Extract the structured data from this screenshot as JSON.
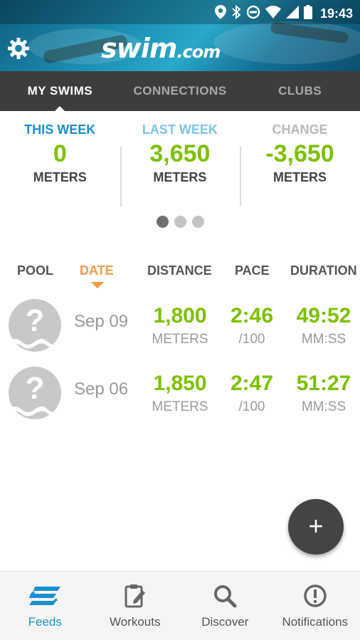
{
  "statusbar": {
    "time": "19:43",
    "icons": [
      "location-icon",
      "bluetooth-icon",
      "do-not-disturb-icon",
      "wifi-icon",
      "cellular-signal-icon",
      "battery-icon"
    ]
  },
  "header": {
    "logo_text_main": "swim",
    "logo_text_suffix": ".com",
    "settings_icon": "gear-icon"
  },
  "tabs": [
    {
      "label": "MY SWIMS",
      "active": true
    },
    {
      "label": "CONNECTIONS",
      "active": false
    },
    {
      "label": "CLUBS",
      "active": false
    }
  ],
  "stats": [
    {
      "label": "THIS WEEK",
      "value": "0",
      "unit": "METERS"
    },
    {
      "label": "LAST WEEK",
      "value": "3,650",
      "unit": "METERS"
    },
    {
      "label": "CHANGE",
      "value": "-3,650",
      "unit": "METERS"
    }
  ],
  "pager": {
    "count": 3,
    "active_index": 0
  },
  "table": {
    "headers": {
      "pool": "POOL",
      "date": "DATE",
      "distance": "DISTANCE",
      "pace": "PACE",
      "duration": "DURATION"
    },
    "sorted_by": "date",
    "rows": [
      {
        "date": "Sep 09",
        "distance": "1,800",
        "distance_unit": "METERS",
        "pace": "2:46",
        "pace_unit": "/100",
        "duration": "49:52",
        "duration_unit": "MM:SS"
      },
      {
        "date": "Sep 06",
        "distance": "1,850",
        "distance_unit": "METERS",
        "pace": "2:47",
        "pace_unit": "/100",
        "duration": "51:27",
        "duration_unit": "MM:SS"
      }
    ]
  },
  "fab": {
    "label": "+"
  },
  "bottom_nav": [
    {
      "label": "Feeds",
      "icon": "feeds-icon",
      "active": true
    },
    {
      "label": "Workouts",
      "icon": "workouts-icon",
      "active": false
    },
    {
      "label": "Discover",
      "icon": "search-icon",
      "active": false
    },
    {
      "label": "Notifications",
      "icon": "alert-icon",
      "active": false
    }
  ],
  "colors": {
    "accent_blue": "#1a8fcf",
    "value_green": "#7cc000",
    "sort_orange": "#f2994a",
    "tab_bar": "#3d3d3d"
  }
}
